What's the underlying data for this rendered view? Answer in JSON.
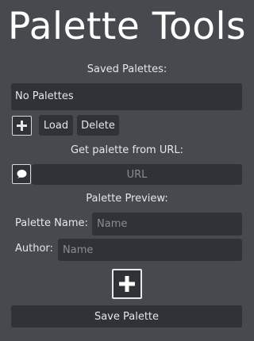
{
  "header": {
    "title": "Palette Tools"
  },
  "saved": {
    "label": "Saved Palettes:",
    "selected": "No Palettes",
    "load_label": "Load",
    "delete_label": "Delete",
    "add_icon": "plus-icon"
  },
  "url_section": {
    "label": "Get palette from URL:",
    "url_placeholder": "URL",
    "paste_icon": "speech-bubble-icon"
  },
  "preview": {
    "label": "Palette Preview:",
    "name_label": "Palette Name:",
    "name_placeholder": "Name",
    "author_label": "Author:",
    "author_placeholder": "Name",
    "add_color_icon": "plus-icon"
  },
  "footer": {
    "save_label": "Save Palette"
  }
}
